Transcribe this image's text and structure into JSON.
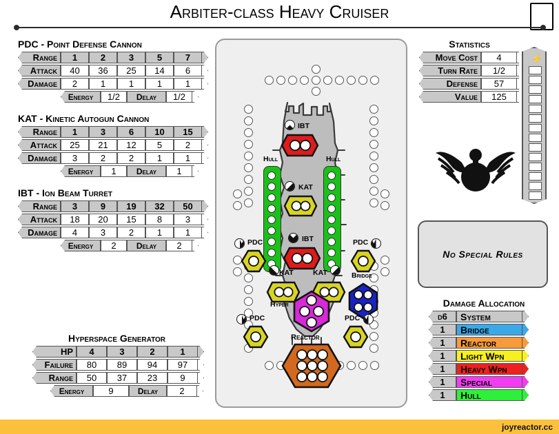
{
  "title": "Arbiter-class Heavy Cruiser",
  "footer": {
    "watermark": "joyreactor.cc"
  },
  "weapons": [
    {
      "key": "pdc",
      "title": "PDC - Point Defense Cannon",
      "row_labels": {
        "range": "Range",
        "attack": "Attack",
        "damage": "Damage"
      },
      "range": [
        "1",
        "2",
        "3",
        "5",
        "7"
      ],
      "attack": [
        "40",
        "36",
        "25",
        "14",
        "6"
      ],
      "damage": [
        "2",
        "1",
        "1",
        "1",
        "1"
      ],
      "energy_label": "Energy",
      "energy": "1/2",
      "delay_label": "Delay",
      "delay": "1/2"
    },
    {
      "key": "kat",
      "title": "KAT - Kinetic Autogun Cannon",
      "row_labels": {
        "range": "Range",
        "attack": "Attack",
        "damage": "Damage"
      },
      "range": [
        "1",
        "3",
        "6",
        "10",
        "15"
      ],
      "attack": [
        "25",
        "21",
        "12",
        "5",
        "2"
      ],
      "damage": [
        "3",
        "2",
        "2",
        "1",
        "1"
      ],
      "energy_label": "Energy",
      "energy": "1",
      "delay_label": "Delay",
      "delay": "1"
    },
    {
      "key": "ibt",
      "title": "IBT - Ion Beam Turret",
      "row_labels": {
        "range": "Range",
        "attack": "Attack",
        "damage": "Damage"
      },
      "range": [
        "3",
        "9",
        "19",
        "32",
        "50"
      ],
      "attack": [
        "18",
        "20",
        "15",
        "8",
        "3"
      ],
      "damage": [
        "4",
        "3",
        "2",
        "1",
        "1"
      ],
      "energy_label": "Energy",
      "energy": "2",
      "delay_label": "Delay",
      "delay": "2"
    }
  ],
  "hyperspace": {
    "title": "Hyperspace Generator",
    "row_labels": {
      "hp": "HP",
      "failure": "Failure",
      "range": "Range"
    },
    "hp": [
      "4",
      "3",
      "2",
      "1"
    ],
    "failure": [
      "80",
      "89",
      "94",
      "97"
    ],
    "range": [
      "50",
      "37",
      "23",
      "9"
    ],
    "energy_label": "Energy",
    "energy": "9",
    "delay_label": "Delay",
    "delay": "2"
  },
  "statistics": {
    "title": "Statistics",
    "rows": [
      {
        "label": "Move Cost",
        "value": "4"
      },
      {
        "label": "Turn Rate",
        "value": "1/2"
      },
      {
        "label": "Defense",
        "value": "57"
      },
      {
        "label": "Value",
        "value": "125"
      }
    ]
  },
  "energy_track": {
    "icon": "lightning-bolt-icon",
    "boxes": 16
  },
  "special_rules": {
    "text": "No Special Rules"
  },
  "damage_allocation": {
    "title": "Damage Allocation",
    "header": {
      "die": "d6",
      "system": "System"
    },
    "rows": [
      {
        "die": "1",
        "system": "Bridge",
        "color": "#3ba9e8"
      },
      {
        "die": "1",
        "system": "Reactor",
        "color": "#f79b3a"
      },
      {
        "die": "1",
        "system": "Light Wpn",
        "color": "#f7f01e"
      },
      {
        "die": "1",
        "system": "Heavy Wpn",
        "color": "#ef2020"
      },
      {
        "die": "1",
        "system": "Special",
        "color": "#f23cf2"
      },
      {
        "die": "1",
        "system": "Hull",
        "color": "#2ef03a"
      }
    ]
  },
  "diagram": {
    "hull_labels": [
      "Hull",
      "Hull"
    ],
    "systems": [
      {
        "name": "IBT",
        "label": "IBT",
        "color": "#e01b1b",
        "pips": 2
      },
      {
        "name": "KAT",
        "label": "KAT",
        "color": "#d8d424",
        "pips": 2
      },
      {
        "name": "IBT2",
        "label": "IBT",
        "color": "#e01b1b",
        "pips": 2
      },
      {
        "name": "KAT-L",
        "label": "KAT",
        "color": "#d8d424",
        "pips": 2
      },
      {
        "name": "KAT-R",
        "label": "KAT",
        "color": "#d8d424",
        "pips": 2
      },
      {
        "name": "Bridge",
        "label": "Bridge",
        "color": "#1a23c8",
        "pips": 4
      },
      {
        "name": "Hyper",
        "label": "Hyper",
        "color": "#d828d8",
        "pips": 4
      },
      {
        "name": "Reactor",
        "label": "Reactor",
        "color": "#d2691e",
        "pips": 9
      },
      {
        "name": "PDC-TL",
        "label": "PDC",
        "color": "#d8d424",
        "pips": 1
      },
      {
        "name": "PDC-TR",
        "label": "PDC",
        "color": "#d8d424",
        "pips": 1
      },
      {
        "name": "PDC-BL",
        "label": "PDC",
        "color": "#d8d424",
        "pips": 1
      },
      {
        "name": "PDC-BR",
        "label": "PDC",
        "color": "#d8d424",
        "pips": 1
      }
    ],
    "hull_track_pips": 9
  }
}
